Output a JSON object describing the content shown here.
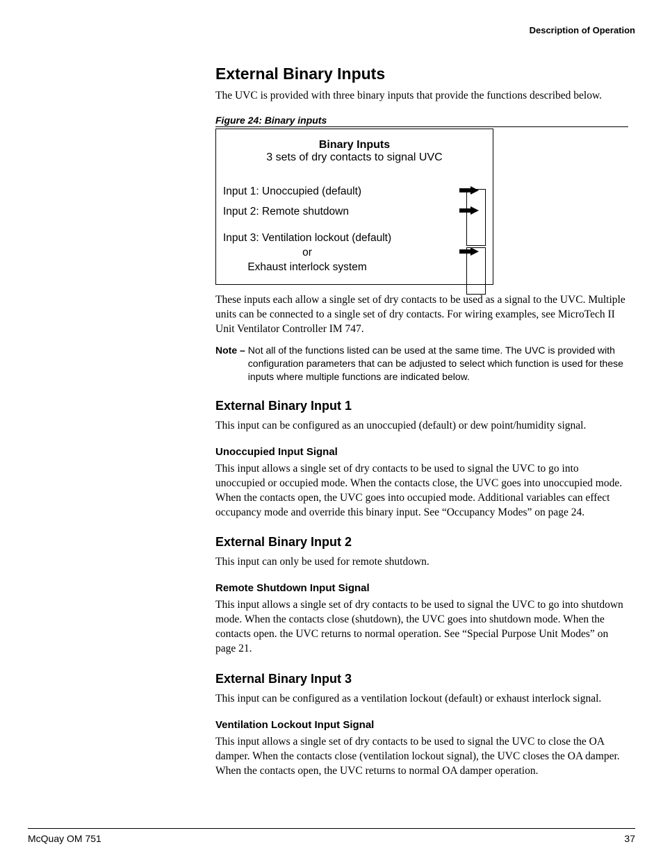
{
  "header": {
    "section": "Description of Operation"
  },
  "main": {
    "title": "External Binary Inputs",
    "intro": "The UVC is provided with three binary inputs that provide the functions described below.",
    "figure_caption": "Figure 24: Binary inputs",
    "diagram": {
      "title": "Binary Inputs",
      "subtitle": "3 sets of dry contacts to signal UVC",
      "input1": "Input 1: Unoccupied (default)",
      "input2": "Input 2: Remote shutdown",
      "input3_line1": "Input 3: Ventilation lockout (default)",
      "input3_line2": "or",
      "input3_line3": "Exhaust interlock system"
    },
    "after_diagram": "These inputs each allow a single set of dry contacts to be used as a signal to the UVC. Multiple units can be connected to a single set of dry contacts. For wiring examples, see MicroTech II Unit Ventilator Controller IM 747.",
    "note_label": "Note –",
    "note_text": "Not all of the functions listed can be used at the same time. The UVC is provided with configuration parameters that can be adjusted to select which function is used for these inputs where multiple functions are indicated below.",
    "sec1": {
      "title": "External Binary Input 1",
      "intro": "This input can be configured as an unoccupied (default) or dew point/humidity signal.",
      "sub_title": "Unoccupied Input Signal",
      "sub_text": "This input allows a single set of dry contacts to be used to signal the UVC to go into unoccupied or occupied mode. When the contacts close, the UVC goes into unoccupied mode. When the contacts open, the UVC goes into occupied mode. Additional variables can effect occupancy mode and override this binary input. See “Occupancy Modes” on page 24."
    },
    "sec2": {
      "title": "External Binary Input 2",
      "intro": "This input can only be used for remote shutdown.",
      "sub_title": "Remote Shutdown Input Signal",
      "sub_text": "This input allows a single set of dry contacts to be used to signal the UVC to go into shutdown mode. When the contacts close (shutdown), the UVC goes into shutdown mode. When the contacts open. the UVC returns to normal operation. See “Special Purpose Unit Modes” on page 21."
    },
    "sec3": {
      "title": "External Binary Input 3",
      "intro": "This input can be configured as a ventilation lockout (default) or exhaust interlock signal.",
      "sub_title": "Ventilation Lockout Input Signal",
      "sub_text": "This input allows a single set of dry contacts to be used to signal the UVC to close the OA damper. When the contacts close (ventilation lockout signal), the UVC closes the OA damper. When the contacts open, the UVC returns to normal OA damper operation."
    }
  },
  "footer": {
    "left": "McQuay OM 751",
    "right": "37"
  }
}
